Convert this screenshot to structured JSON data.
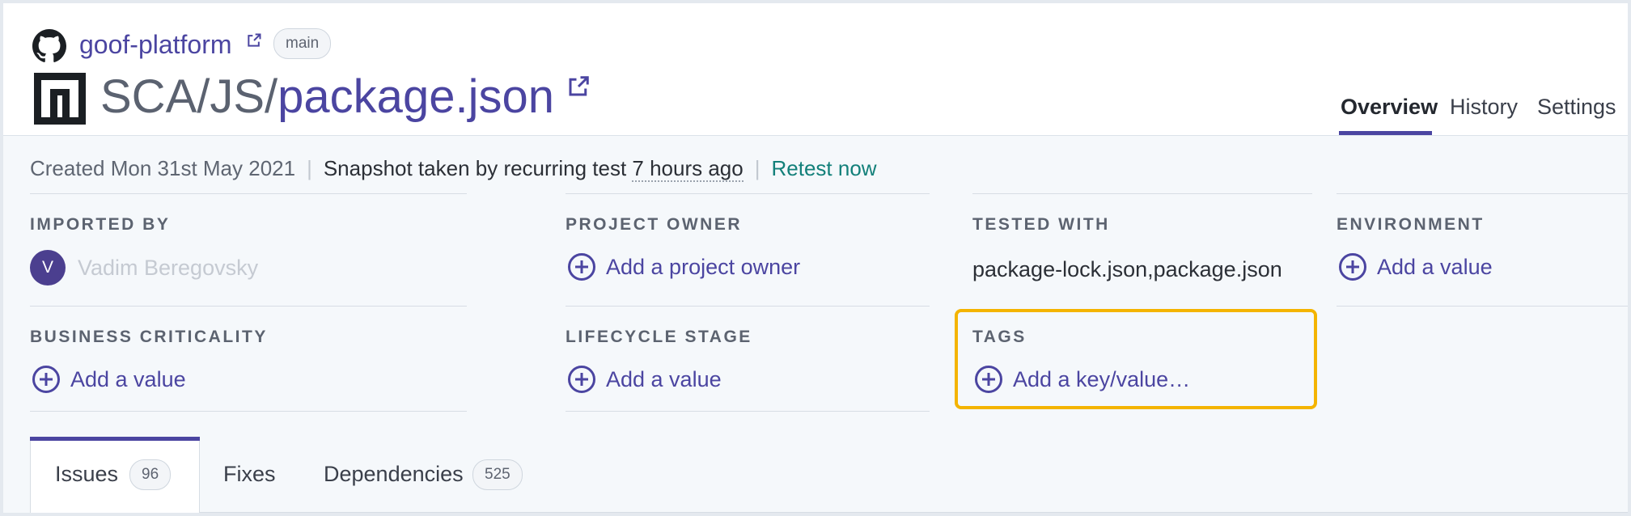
{
  "header": {
    "repo_link": "goof-platform",
    "branch": "main",
    "title_prefix": "SCA/JS/",
    "title_name": "package.json",
    "icons": {
      "repo": "github-icon",
      "project": "npm-logo",
      "external": "external-link-icon"
    }
  },
  "nav": {
    "overview": "Overview",
    "history": "History",
    "settings": "Settings",
    "active": "Overview"
  },
  "meta": {
    "created": "Created Mon 31st May 2021",
    "snapshot": "Snapshot taken by recurring test",
    "snapshot_ago": "7 hours ago",
    "retest": "Retest now"
  },
  "attributes": {
    "imported_by": {
      "label": "IMPORTED BY",
      "avatar_initial": "V",
      "name": "Vadim Beregovsky"
    },
    "project_owner": {
      "label": "PROJECT OWNER",
      "action": "Add a project owner"
    },
    "tested_with": {
      "label": "TESTED WITH",
      "value": "package-lock.json,package.json"
    },
    "environment": {
      "label": "ENVIRONMENT",
      "action": "Add a value"
    },
    "business_criticality": {
      "label": "BUSINESS CRITICALITY",
      "action": "Add a value"
    },
    "lifecycle_stage": {
      "label": "LIFECYCLE STAGE",
      "action": "Add a value"
    },
    "tags": {
      "label": "TAGS",
      "action": "Add a key/value…"
    }
  },
  "tabs": {
    "issues": {
      "label": "Issues",
      "count": "96"
    },
    "fixes": {
      "label": "Fixes"
    },
    "dependencies": {
      "label": "Dependencies",
      "count": "525"
    },
    "active": "Issues"
  },
  "colors": {
    "accent": "#4b45a1",
    "retest": "#13807a",
    "highlight": "#f4b400"
  }
}
